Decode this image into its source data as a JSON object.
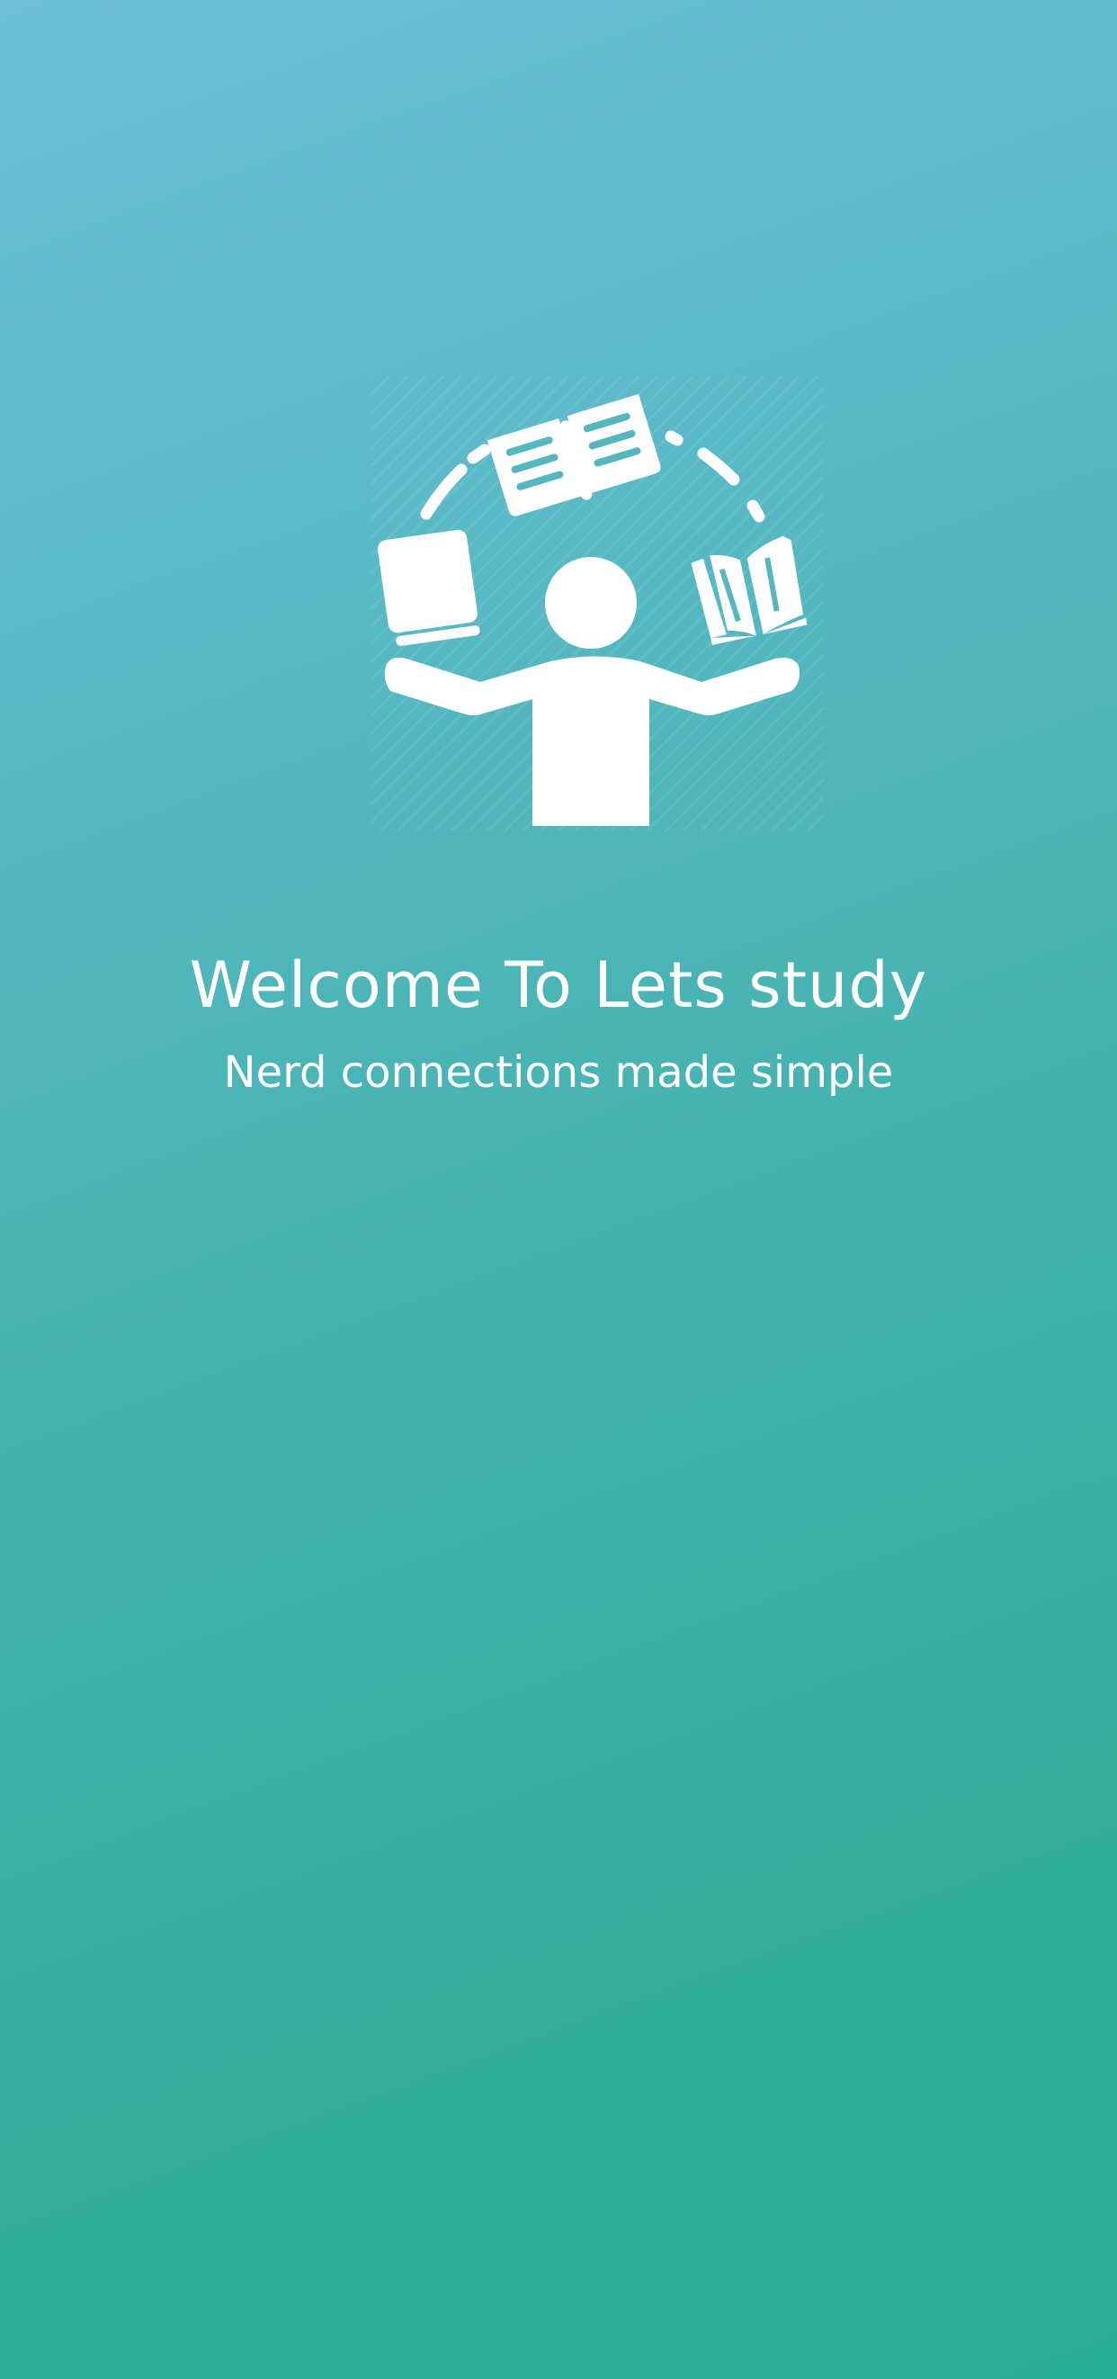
{
  "welcome": {
    "title": "Welcome To Lets study",
    "subtitle": "Nerd connections made simple",
    "illustration_icon": "person-juggling-books-icon"
  },
  "colors": {
    "gradient_top": "#6cbfd6",
    "gradient_bottom": "#28ad95",
    "text": "#ffffff"
  }
}
